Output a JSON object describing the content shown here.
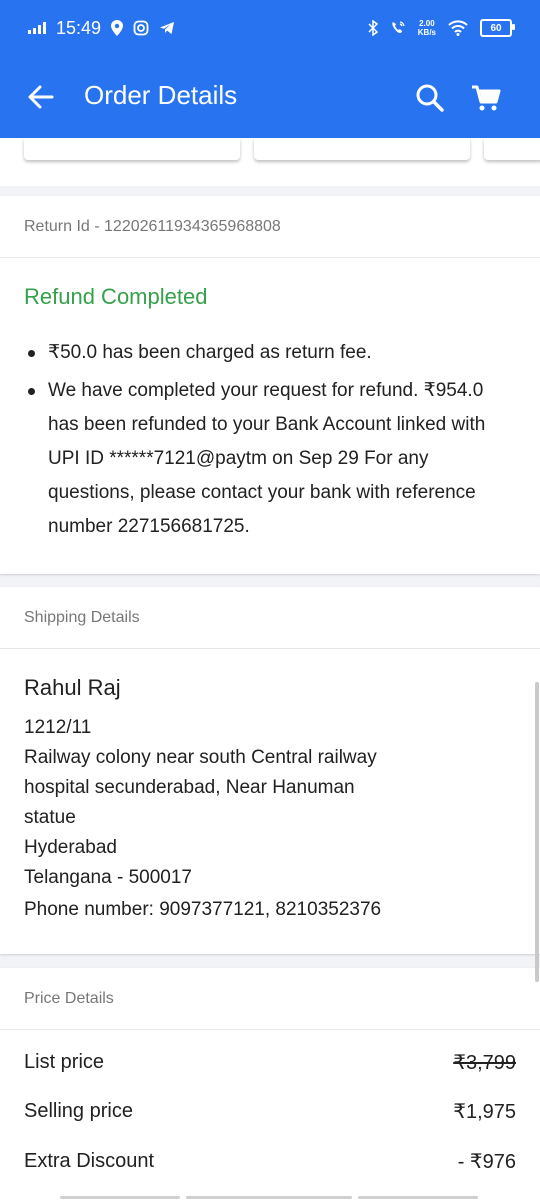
{
  "status_bar": {
    "time": "15:49",
    "net_speed_value": "2.00",
    "net_speed_unit": "KB/s",
    "battery": "60"
  },
  "app_bar": {
    "title": "Order Details"
  },
  "return_card": {
    "return_id": "Return Id - 12202611934365968808",
    "status_title": "Refund Completed",
    "bullets": [
      "₹50.0 has been charged as return fee.",
      "We have completed your request for refund. ₹954.0 has been refunded to your Bank Account linked with UPI ID ******7121@paytm on Sep 29 For any questions, please contact your bank with reference number 227156681725."
    ]
  },
  "shipping": {
    "header": "Shipping Details",
    "name": "Rahul Raj",
    "address_lines": [
      "1212/11",
      "Railway colony near south Central railway",
      "hospital secunderabad, Near Hanuman",
      "statue",
      "Hyderabad",
      "Telangana - 500017"
    ],
    "phone": "Phone number: 9097377121, 8210352376"
  },
  "price_details": {
    "header": "Price Details",
    "rows": [
      {
        "label": "List price",
        "value": "₹3,799"
      },
      {
        "label": "Selling price",
        "value": "₹1,975"
      },
      {
        "label": "Extra Discount",
        "value": "- ₹976"
      }
    ]
  },
  "colors": {
    "brand_blue": "#2874f0",
    "success_green": "#36a14a"
  },
  "icons": {
    "back": "arrow-left-icon",
    "search": "search-icon",
    "cart": "cart-icon"
  }
}
